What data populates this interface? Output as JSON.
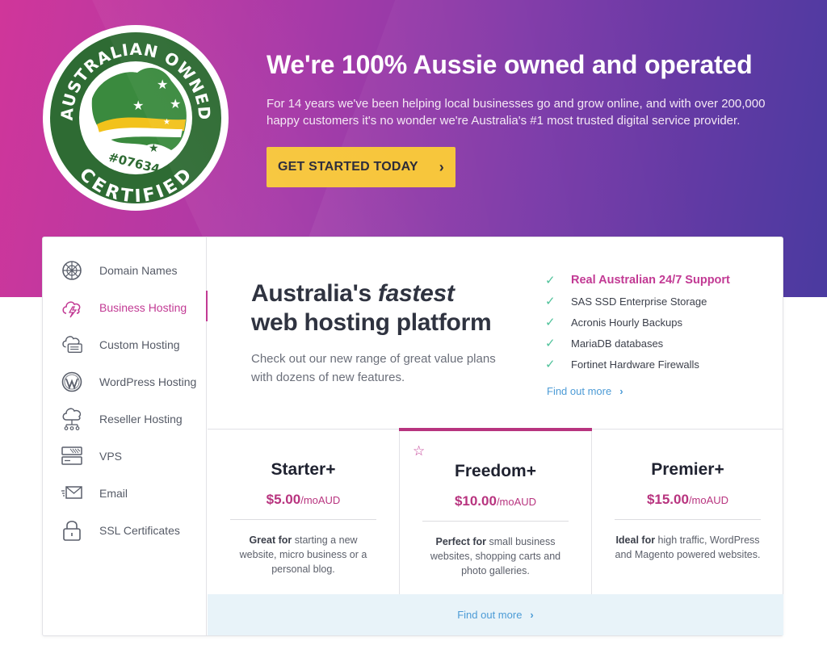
{
  "badge": {
    "top_text": "AUSTRALIAN OWNED",
    "bottom_text": "CERTIFIED",
    "number": "#07634"
  },
  "hero": {
    "title": "We're 100% Aussie owned and operated",
    "subtitle": "For 14 years we've been helping local businesses go and grow online, and with over 200,000 happy customers it's no wonder we're Australia's #1 most trusted digital service provider.",
    "cta_label": "GET STARTED TODAY",
    "cta_chevron": "›"
  },
  "sidebar": {
    "items": [
      {
        "label": "Domain Names",
        "icon": "globe-icon"
      },
      {
        "label": "Business Hosting",
        "icon": "cloud-bolt-icon",
        "active": true
      },
      {
        "label": "Custom Hosting",
        "icon": "cloud-server-icon"
      },
      {
        "label": "WordPress Hosting",
        "icon": "wordpress-icon"
      },
      {
        "label": "Reseller Hosting",
        "icon": "cloud-network-icon"
      },
      {
        "label": "VPS",
        "icon": "server-stack-icon"
      },
      {
        "label": "Email",
        "icon": "envelope-icon"
      },
      {
        "label": "SSL Certificates",
        "icon": "padlock-icon"
      }
    ]
  },
  "main": {
    "headline_part1": "Australia's ",
    "headline_emph": "fastest",
    "headline_part2": "web hosting platform",
    "description": "Check out our new range of great value plans with dozens of new features.",
    "features": [
      "Real Australian 24/7 Support",
      "SAS SSD Enterprise Storage",
      "Acronis Hourly Backups",
      "MariaDB databases",
      "Fortinet Hardware Firewalls"
    ],
    "find_more": "Find out more",
    "chevron": "›"
  },
  "plans": [
    {
      "name": "Starter+",
      "price": "$5.00",
      "unit": "/moAUD",
      "lead": "Great for",
      "desc": " starting a new website, micro business or a personal blog."
    },
    {
      "name": "Freedom+",
      "price": "$10.00",
      "unit": "/moAUD",
      "lead": "Perfect for",
      "desc": " small business websites,  shopping carts and photo galleries.",
      "featured": true
    },
    {
      "name": "Premier+",
      "price": "$15.00",
      "unit": "/moAUD",
      "lead": "Ideal for",
      "desc": " high traffic, WordPress and Magento powered websites."
    }
  ],
  "bottom": {
    "find_more": "Find out more",
    "chevron": "›"
  },
  "colors": {
    "accent": "#c23a94",
    "cta": "#f7c63c",
    "check": "#4fc29a",
    "link": "#4c9bd6",
    "badge_green": "#2e6b33",
    "badge_yellow": "#f2c21b"
  }
}
